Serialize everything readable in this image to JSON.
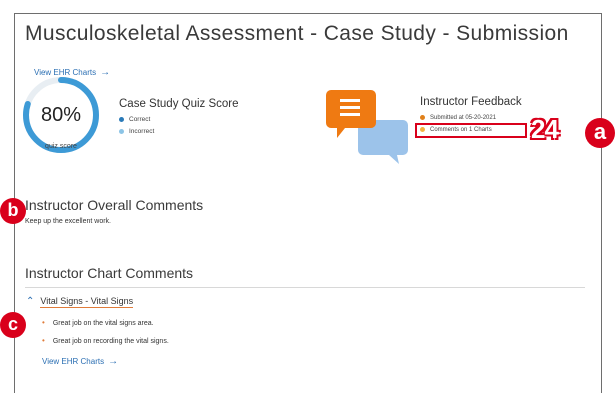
{
  "header": {
    "title": "Musculoskeletal Assessment - Case Study - Submission",
    "ehr_link": "View EHR Charts",
    "ehr_arrow": "→"
  },
  "quiz": {
    "score_pct": "80%",
    "score_value": 0.8,
    "caption": "quiz score",
    "title": "Case Study Quiz Score",
    "legend": [
      {
        "label": "Correct",
        "color": "#2a7ab8"
      },
      {
        "label": "Incorrect",
        "color": "#8cc4e6"
      }
    ]
  },
  "feedback": {
    "title": "Instructor Feedback",
    "items": [
      {
        "label": "Submitted at 05-20-2021",
        "color": "#e0801a"
      },
      {
        "label": "Comments on 1 Charts",
        "color": "#f3b342"
      }
    ]
  },
  "overall": {
    "title": "Instructor Overall Comments",
    "text": "Keep up the excellent work."
  },
  "chart_comments": {
    "title": "Instructor Chart Comments",
    "group": "Vital Signs - Vital Signs",
    "chevron": "^",
    "comments": [
      "Great job on the vital signs area.",
      "Great job on recording the vital signs."
    ],
    "link": "View EHR Charts",
    "link_arrow": "→"
  },
  "annotations": {
    "number": "24",
    "a": "a",
    "b": "b",
    "c": "c"
  },
  "colors": {
    "accent_blue": "#2b6fb3",
    "gauge_blue": "#3d9ad6",
    "annotation_red": "#d9001b",
    "bullet_orange": "#e07b39"
  }
}
